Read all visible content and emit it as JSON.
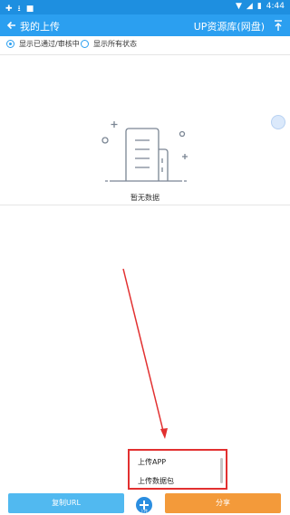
{
  "status_bar": {
    "time": "4:44"
  },
  "app_bar": {
    "title": "我的上传",
    "right_title": "UP资源库(网盘)"
  },
  "filters": {
    "option1": "显示已通过/审核中",
    "option2": "显示所有状态"
  },
  "empty_state": {
    "message": "暂无数据"
  },
  "popup_menu": {
    "items": [
      "上传APP",
      "上传数据包"
    ]
  },
  "bottom_bar": {
    "copy_url": "复制URL",
    "share": "分享",
    "fab_label": "上传"
  },
  "colors": {
    "primary": "#2b9ff0",
    "accent": "#f39a3a",
    "highlight": "#e23030"
  }
}
